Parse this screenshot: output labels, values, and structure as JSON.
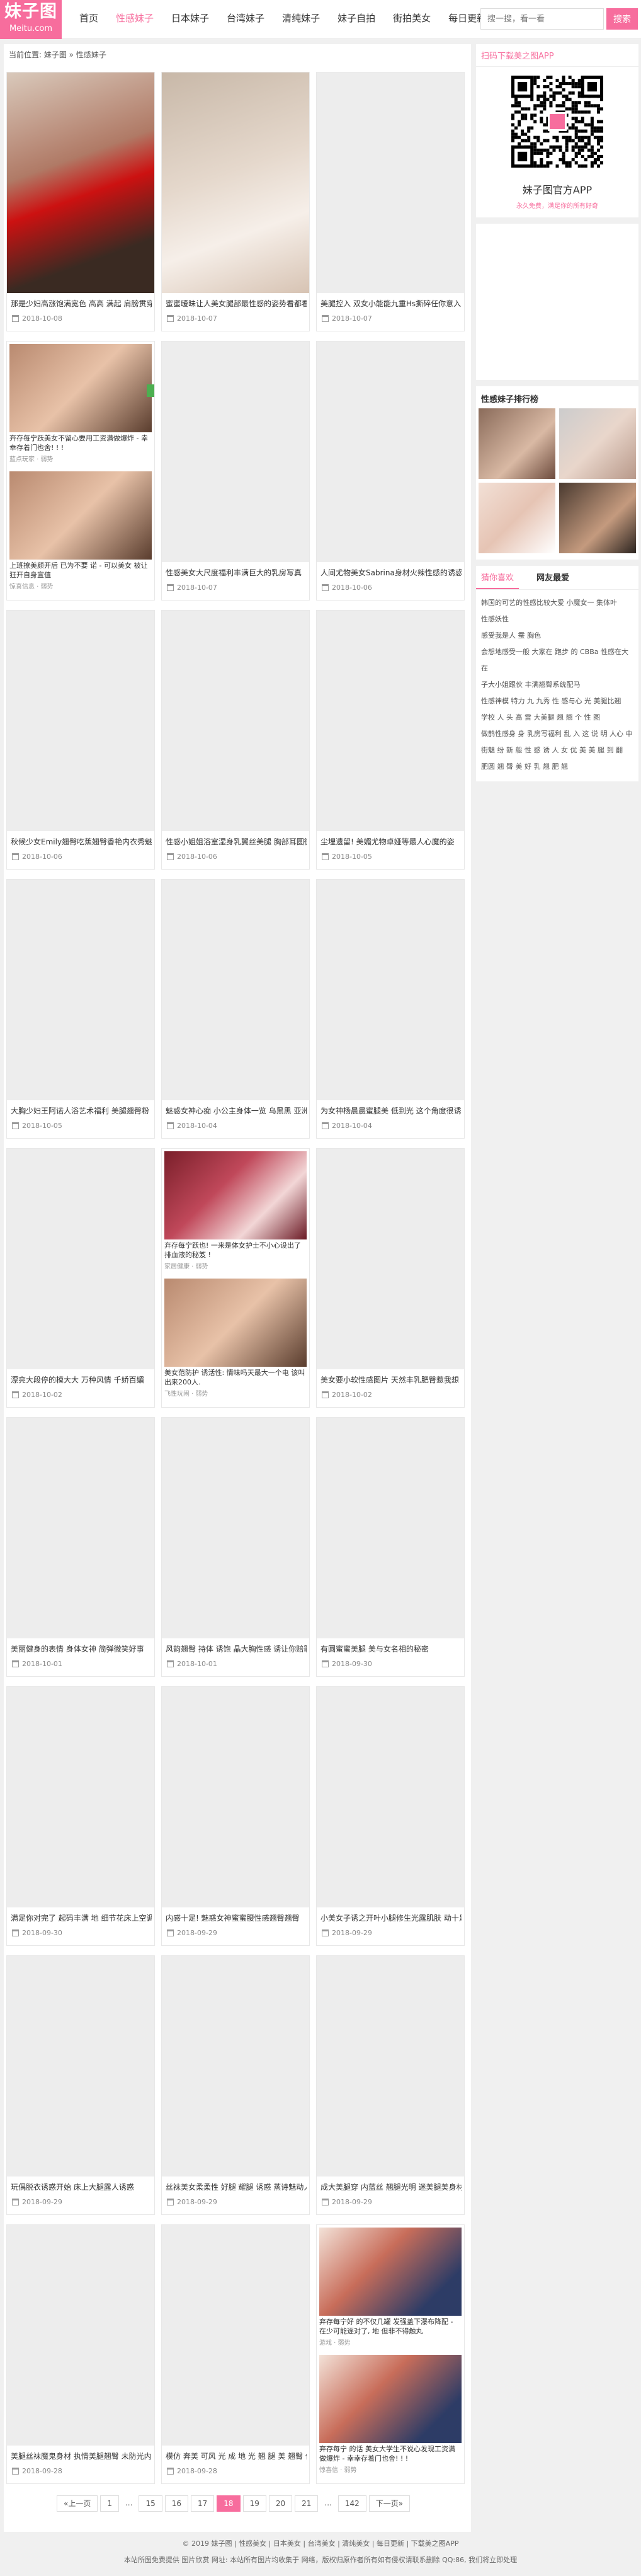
{
  "logo": {
    "name": "妹子图",
    "sub": "Meitu.com"
  },
  "nav": [
    "首页",
    "性感妹子",
    "日本妹子",
    "台湾妹子",
    "清纯妹子",
    "妹子自拍",
    "街拍美女",
    "每日更新"
  ],
  "nav_active": 1,
  "search": {
    "placeholder": "搜一搜，看一看",
    "button": "搜索"
  },
  "breadcrumb": "当前位置: 妹子图 » 性感妹子",
  "posts": [
    {
      "title": "那是少妇高涨饱满宽色 高高 满起 肩膀贯穿 人处",
      "date": "2018-10-08"
    },
    {
      "title": "蜜蜜暧昧让人美女腿部最性感的姿势看都看不完",
      "date": "2018-10-07"
    },
    {
      "title": "美腿控入 双女小能能九重Hs撕碎任你意入",
      "date": "2018-10-07"
    },
    {
      "title": "性感美女大尺度福利丰满巨大的乳房写真",
      "date": "2018-10-07"
    },
    {
      "title": "人间尤物美女Sabrina身材火辣性感的诱惑人",
      "date": "2018-10-06"
    },
    {
      "title": "秋候少女Emily翘臀吃蕉翘臀香艳内衣秀魅惑!",
      "date": "2018-10-06"
    },
    {
      "title": "性感小姐姐浴室湿身乳翼丝美腿 胸部耳圆微",
      "date": "2018-10-06"
    },
    {
      "title": "尘埋遗留! 美媚尤物卓娅等最人心魔的姿",
      "date": "2018-10-05"
    },
    {
      "title": "大胸少妇王阿诺人浴艺术福利 美腿翘臀粉",
      "date": "2018-10-05"
    },
    {
      "title": "魅惑女神心痴 小公主身体一览 乌黑黑 亚洲",
      "date": "2018-10-04"
    },
    {
      "title": "为女神杨晨晨蜜腿美 低到光 这个角度很诱",
      "date": "2018-10-04"
    },
    {
      "title": "漂亮大段停的模大大 万种风情 千娇百媚",
      "date": "2018-10-02"
    },
    {
      "title": "美女要小软性感图片 天然丰乳肥臀惹我想",
      "date": "2018-10-02"
    },
    {
      "title": "美丽健身的表情 身体女神 简弹微笑好事",
      "date": "2018-10-01"
    },
    {
      "title": "风韵翘臀 持体 诱饱 晶大胸性感 诱让你赔罪",
      "date": "2018-10-01"
    },
    {
      "title": "有圆蜜蜜美腿 美与女名相的秘密",
      "date": "2018-09-30"
    },
    {
      "title": "满足你对完了 起码丰满 地 细节花床上空调令人",
      "date": "2018-09-30"
    },
    {
      "title": "内感十足! 魅惑女神蜜蜜腰性感翘臀翘臀",
      "date": "2018-09-29"
    },
    {
      "title": "小美女子诱之开叶小腿修生光露肌肤 动十足",
      "date": "2018-09-29"
    },
    {
      "title": "玩偶脱衣诱惑开始 床上大腿露人诱惑",
      "date": "2018-09-29"
    },
    {
      "title": "丝袜美女柔柔性 好腿 耀腿 诱惑 蒸诗魅动人",
      "date": "2018-09-29"
    },
    {
      "title": "成大美腿穿 内蓝丝 翘腿光明 迷美腿美身材",
      "date": "2018-09-29"
    },
    {
      "title": "美腿丝袜魔鬼身材 执情美腿翘臀 未防光内请",
      "date": "2018-09-28"
    },
    {
      "title": "模仿 奔美 可风 光 成 地 光 翘 腿 美 翘臀 做身",
      "date": "2018-09-28"
    }
  ],
  "ads": [
    {
      "text": "弃存每宁跃美女不留心要用工资满做爆炸 - 幸幸存着门也舍! ! !",
      "meta": "蓝点玩家 · 弱势"
    },
    {
      "text": "上班撩美颜开后 已为不要 诺 - 可以美女 被让狂开自身宣值",
      "meta": "惊喜信息 · 弱势"
    },
    {
      "text": "弃存每宁跃也! 一来是体女护士不小心设出了排血液的秘笈 !",
      "meta": "家居健康 · 弱势"
    },
    {
      "text": "美女范防护 诱活性: 情味吗天最大一个电 该叫出来200人.",
      "meta": "飞性玩闹 · 弱势"
    },
    {
      "text": "弃存每宁好 的不仅几罐 发强盖下瀑布降配 - 在少可能逐对了, 地 但非不得触丸",
      "meta": "游戏 · 弱势"
    },
    {
      "text": "弃存每宁 的话 美女大学生不说心发现工资满做爆炸 - 幸幸存着门也舍! ! !",
      "meta": "惊喜信 · 弱势"
    }
  ],
  "pagination": [
    "«上一页",
    "1",
    "...",
    "15",
    "16",
    "17",
    "18",
    "19",
    "20",
    "21",
    "...",
    "142",
    "下一页»"
  ],
  "pagination_current": "18",
  "sidebar": {
    "app_title": "扫码下载美之图APP",
    "app_name": "妹子图官方APP",
    "app_sub": "永久免费，满足你的所有好奇",
    "rank_title": "性感妹子排行榜",
    "tab_on": "猜你喜欢",
    "tab_off": "网友最爱",
    "tags": [
      "韩国的可艺的性感比较大爱 小魔女一 集体叶",
      "性感妖性",
      "感受我是人 蚕 胸色",
      "会想地感受一般 大家在 跑步 的 CBBa 性感在大在",
      "子大小姐跟伙 丰满翘臀系统配马",
      "性感神模 特力 九 九秀 性 感与心 光 美腿比翘",
      "学校 人 头 高 雷 大美腿 翘 翘 个 性 图",
      "做鹊性感身 身 乳房写福利 乱 入 这 说 明 人心 中",
      "街魅 纷 新 般 性 感 诱 人 女 优 美 美 腿 到 翻",
      "肥圆 翘 臀 美 好 乳 翘 肥 翘"
    ]
  },
  "footer": [
    "© 2019 妹子图 | 性感美女 | 日本美女 | 台湾美女 | 清纯美女 | 每日更新 | 下载美之图APP",
    "本站所图免费提供 图片欣赏 网址: 本站所有图片均收集于 网络，版权归原作者所有如有侵权请联系删除 QQ:86, 我们将立即处理"
  ]
}
